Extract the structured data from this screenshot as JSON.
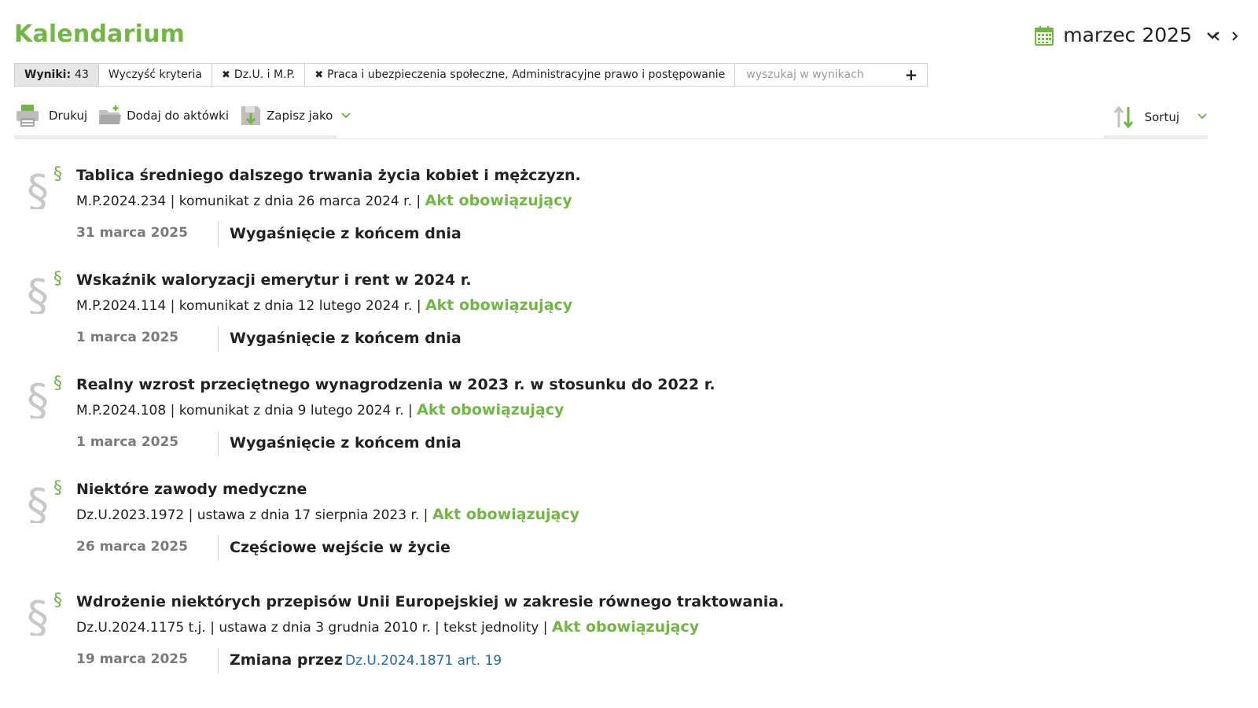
{
  "header": {
    "title": "Kalendarium",
    "month": "marzec 2025"
  },
  "filters": {
    "results_label": "Wyniki:",
    "results_count": "43",
    "clear_label": "Wyczyść kryteria",
    "chips": [
      "Dz.U. i M.P.",
      "Praca i ubezpieczenia społeczne, Administracyjne prawo i postępowanie"
    ],
    "search_placeholder": "wyszukaj w wynikach"
  },
  "toolbar": {
    "print_label": "Drukuj",
    "add_label": "Dodaj do aktówki",
    "save_label": "Zapisz jako",
    "sort_label": "Sortuj"
  },
  "colors": {
    "accent": "#72b646",
    "link": "#1f6aa8",
    "date": "#7a7a7a"
  },
  "items": [
    {
      "title": "Tablica średniego dalszego trwania życia kobiet i mężczyzn.",
      "meta": "M.P.2024.234 | komunikat z dnia 26 marca 2024 r. |",
      "status": "Akt obowiązujący",
      "date": "31 marca 2025",
      "event": "Wygaśnięcie z końcem dnia",
      "link": ""
    },
    {
      "title": "Wskaźnik waloryzacji emerytur i rent w 2024 r.",
      "meta": "M.P.2024.114 | komunikat z dnia 12 lutego 2024 r. |",
      "status": "Akt obowiązujący",
      "date": "1 marca 2025",
      "event": "Wygaśnięcie z końcem dnia",
      "link": ""
    },
    {
      "title": "Realny wzrost przeciętnego wynagrodzenia w 2023 r. w stosunku do 2022 r.",
      "meta": "M.P.2024.108 | komunikat z dnia 9 lutego 2024 r. |",
      "status": "Akt obowiązujący",
      "date": "1 marca 2025",
      "event": "Wygaśnięcie z końcem dnia",
      "link": ""
    },
    {
      "title": "Niektóre zawody medyczne",
      "meta": "Dz.U.2023.1972 | ustawa z dnia 17 sierpnia 2023 r. |",
      "status": "Akt obowiązujący",
      "date": "26 marca 2025",
      "event": "Częściowe wejście w życie",
      "link": ""
    },
    {
      "title": "Wdrożenie niektórych przepisów Unii Europejskiej w zakresie równego traktowania.",
      "meta": "Dz.U.2024.1175 t.j. | ustawa z dnia 3 grudnia 2010 r. | tekst jednolity |",
      "status": "Akt obowiązujący",
      "date": "19 marca 2025",
      "event": "Zmiana przez",
      "link": "Dz.U.2024.1871 art. 19"
    }
  ]
}
